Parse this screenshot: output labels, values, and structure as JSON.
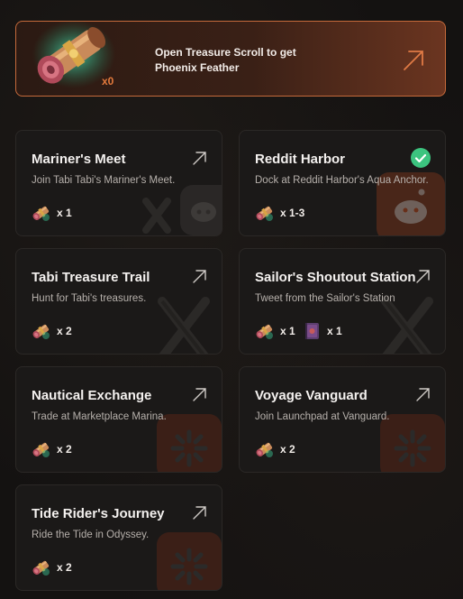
{
  "banner": {
    "text_line1": "Open Treasure Scroll to get",
    "text_line2": "Phoenix Feather",
    "count": "x0"
  },
  "cards": [
    {
      "title": "Mariner's Meet",
      "description": "Join Tabi Tabi's Mariner's Meet.",
      "rewards": [
        {
          "icon": "scroll-icon",
          "qty": "x 1"
        }
      ],
      "status": "arrow",
      "decoration": "x-discord-icon"
    },
    {
      "title": "Reddit Harbor",
      "description": "Dock at Reddit Harbor's Aqua Anchor.",
      "rewards": [
        {
          "icon": "scroll-icon",
          "qty": "x 1-3"
        }
      ],
      "status": "completed",
      "decoration": "reddit-icon"
    },
    {
      "title": "Tabi Treasure Trail",
      "description": "Hunt for Tabi's treasures.",
      "rewards": [
        {
          "icon": "scroll-icon",
          "qty": "x 2"
        }
      ],
      "status": "arrow",
      "decoration": "x-icon"
    },
    {
      "title": "Sailor's Shoutout Station",
      "description": "Tweet from the Sailor's Station",
      "rewards": [
        {
          "icon": "scroll-icon",
          "qty": "x 1"
        },
        {
          "icon": "book-icon",
          "qty": "x 1"
        }
      ],
      "status": "arrow",
      "decoration": "x-icon"
    },
    {
      "title": "Nautical Exchange",
      "description": "Trade at Marketplace Marina.",
      "rewards": [
        {
          "icon": "scroll-icon",
          "qty": "x 2"
        }
      ],
      "status": "arrow",
      "decoration": "tabi-icon"
    },
    {
      "title": "Voyage Vanguard",
      "description": "Join Launchpad at Vanguard.",
      "rewards": [
        {
          "icon": "scroll-icon",
          "qty": "x 2"
        }
      ],
      "status": "arrow",
      "decoration": "tabi-icon"
    },
    {
      "title": "Tide Rider's Journey",
      "description": "Ride the Tide in Odyssey.",
      "rewards": [
        {
          "icon": "scroll-icon",
          "qty": "x 2"
        }
      ],
      "status": "arrow",
      "decoration": "tabi-icon"
    }
  ],
  "colors": {
    "accent": "#e47a3c",
    "check": "#3cc47f",
    "card_bg": "#1b1918"
  }
}
